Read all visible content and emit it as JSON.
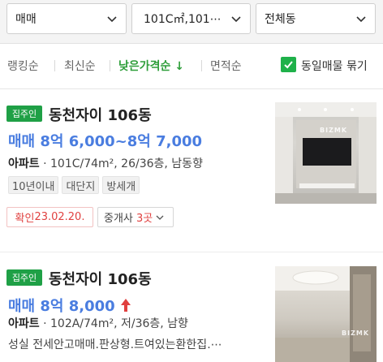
{
  "filters": {
    "deal_type": "매매",
    "area": "101C㎡,101⋯",
    "dong": "전체동"
  },
  "sort": {
    "items": [
      "랭킹순",
      "최신순",
      "낮은가격순",
      "면적순"
    ],
    "active_arrow": "↓",
    "same_listing_toggle_label": "동일매물 묶기",
    "same_listing_checked": true
  },
  "listings": [
    {
      "badge": "집주인",
      "title": "동천자이 106동",
      "price": "매매 8억 6,000~8억 7,000",
      "type": "아파트",
      "detail": "101C/74m², 26/36층, 남동향",
      "tags": [
        "10년이내",
        "대단지",
        "방세개"
      ],
      "confirm_label": "확인",
      "confirm_date": "23.02.20.",
      "agent_label": "중개사",
      "agent_count": "3곳",
      "watermark": "BIZMK"
    },
    {
      "badge": "집주인",
      "title": "동천자이 106동",
      "price": "매매 8억 8,000",
      "type": "아파트",
      "detail": "102A/74m², 저/36층, 남향",
      "snippet": "성실 전세안고매매.판상형.트여있는환한집.⋯",
      "watermark": "BIZMK"
    }
  ],
  "colors": {
    "accent_green": "#1fa046",
    "price_blue": "#4a7de0",
    "alert_red": "#e0403f"
  }
}
